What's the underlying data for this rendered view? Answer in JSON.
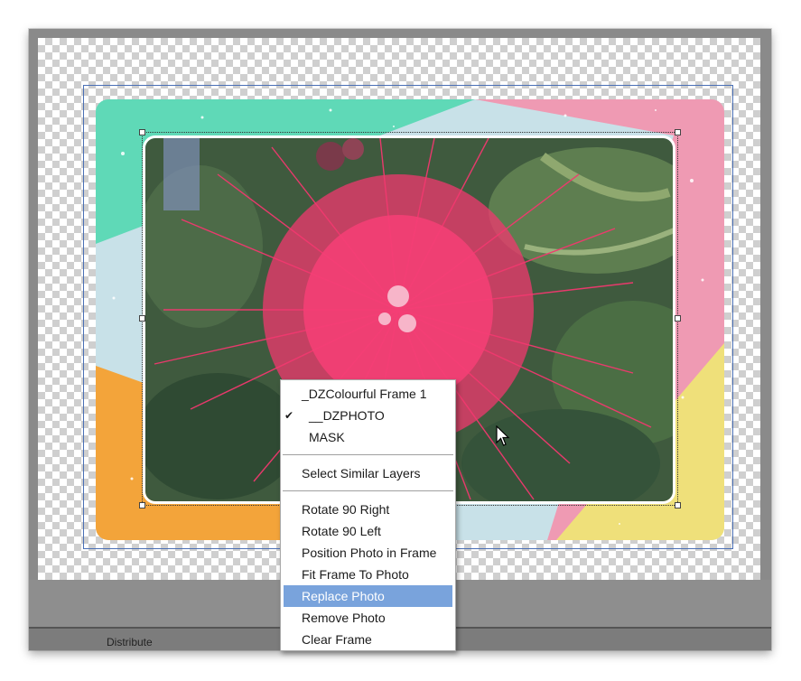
{
  "menu": {
    "items_group1": [
      {
        "label": "_DZColourful Frame 1",
        "checked": false
      },
      {
        "label": "__DZPHOTO",
        "checked": true
      },
      {
        "label": "MASK",
        "checked": false
      }
    ],
    "check_glyph": "✔",
    "select_similar": "Select Similar Layers",
    "items_group3": [
      {
        "label": "Rotate 90 Right"
      },
      {
        "label": "Rotate 90 Left"
      },
      {
        "label": "Position Photo in Frame"
      },
      {
        "label": "Fit Frame To Photo"
      },
      {
        "label": "Replace Photo",
        "highlighted": true
      },
      {
        "label": "Remove Photo"
      },
      {
        "label": "Clear Frame"
      }
    ]
  },
  "status": {
    "text": "Distribute"
  },
  "colors": {
    "highlight": "#79a3dc",
    "frame_teal": "#5fd9b7",
    "frame_pink": "#ef9ab3",
    "frame_orange": "#f3a43a",
    "frame_yellow": "#efe07a",
    "frame_lightblue": "#c8e1e8",
    "flower": "#f2386f"
  }
}
